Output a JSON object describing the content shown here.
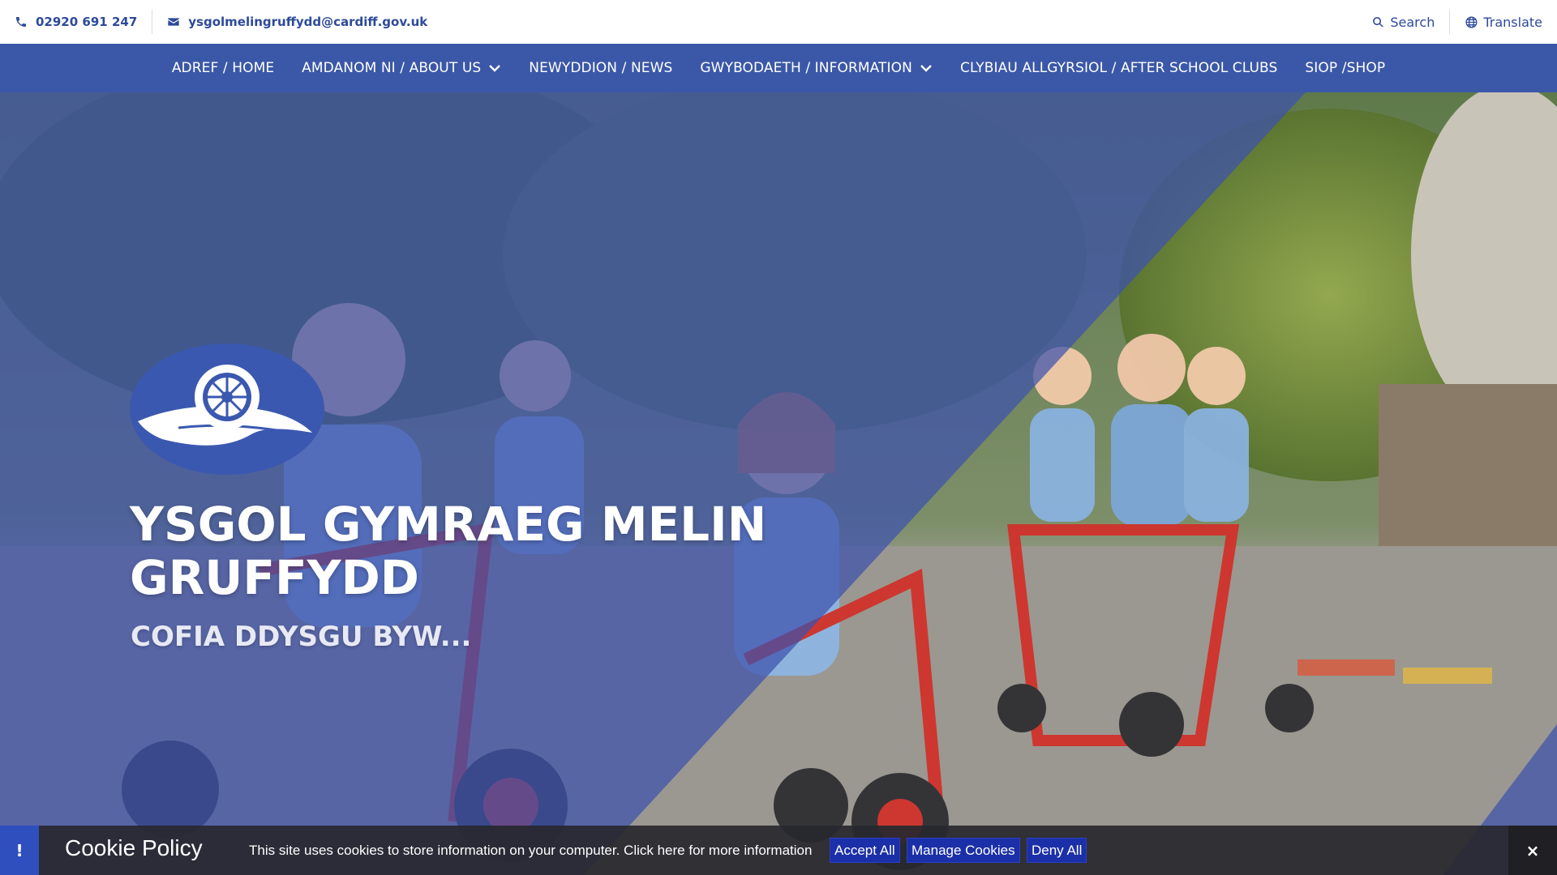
{
  "topbar": {
    "phone": "02920 691 247",
    "email": "ysgolmelingruffydd@cardiff.gov.uk",
    "search_label": "Search",
    "translate_label": "Translate"
  },
  "nav": {
    "items": [
      {
        "label": "ADREF / HOME",
        "dropdown": false
      },
      {
        "label": "AMDANOM NI / ABOUT US",
        "dropdown": true
      },
      {
        "label": "NEWYDDION / NEWS",
        "dropdown": false
      },
      {
        "label": "GWYBODAETH / INFORMATION",
        "dropdown": true
      },
      {
        "label": "CLYBIAU ALLGYRSIOL / AFTER SCHOOL CLUBS",
        "dropdown": false
      },
      {
        "label": "SIOP /SHOP",
        "dropdown": false
      }
    ]
  },
  "hero": {
    "title": "YSGOL GYMRAEG MELIN GRUFFYDD",
    "subtitle": "COFIA DDYSGU BYW..."
  },
  "cookie": {
    "alert_symbol": "!",
    "title": "Cookie Policy",
    "message": "This site uses cookies to store information on your computer. Click here for more information",
    "accept_label": "Accept All",
    "manage_label": "Manage Cookies",
    "deny_label": "Deny All",
    "close_symbol": "×"
  },
  "colors": {
    "brand_blue": "#3b58a8",
    "text_blue": "#2d4a9a",
    "cookie_button": "#1b2fa8",
    "overlay_blue": "#3f56b0"
  },
  "icons": [
    "phone-icon",
    "envelope-icon",
    "search-icon",
    "globe-icon",
    "chevron-down-icon",
    "school-crest-logo"
  ]
}
